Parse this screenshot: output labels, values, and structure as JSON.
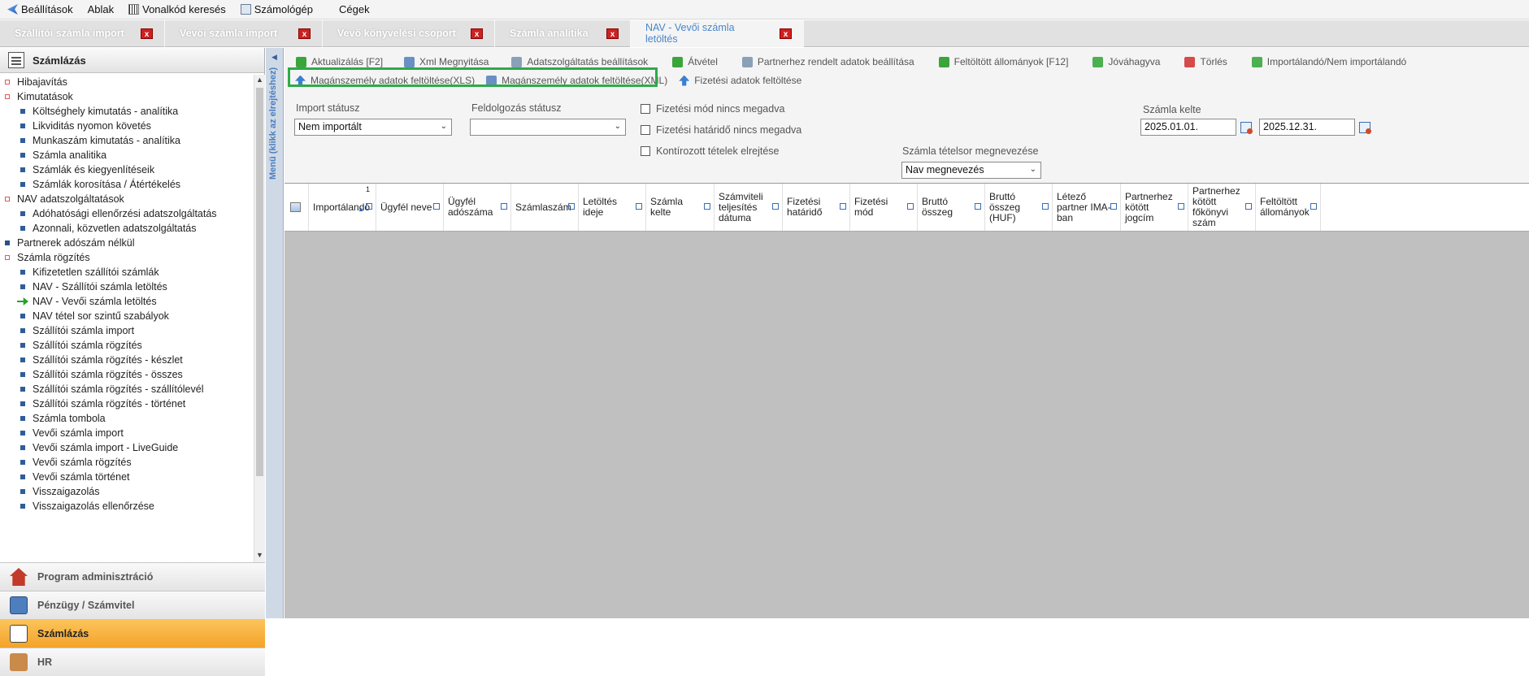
{
  "menubar": {
    "items": [
      {
        "label": "Beállítások",
        "icon": "arrow-icon"
      },
      {
        "label": "Ablak"
      },
      {
        "label": "Vonalkód keresés",
        "icon": "barcode-icon"
      },
      {
        "label": "Számológép",
        "icon": "calculator-icon"
      },
      {
        "label": "Cégek"
      }
    ]
  },
  "tabs": [
    {
      "label": "Szállítói számla import"
    },
    {
      "label": "Vevői számla import"
    },
    {
      "label": "Vevő könyvelési csoport"
    },
    {
      "label": "Számla analitika"
    },
    {
      "label": "NAV - Vevői számla letöltés",
      "active": true
    }
  ],
  "tab_close_glyph": "x",
  "sidebar": {
    "title": "Számlázás",
    "menu_strip_label": "Menü (klikk az elrejtéshez)",
    "tree": [
      {
        "label": "Hibajavítás",
        "level": 0
      },
      {
        "label": "Kimutatások",
        "level": 0
      },
      {
        "label": "Költséghely kimutatás - analítika",
        "level": 1
      },
      {
        "label": "Likviditás nyomon követés",
        "level": 1
      },
      {
        "label": "Munkaszám kimutatás - analítika",
        "level": 1
      },
      {
        "label": "Számla analitika",
        "level": 1
      },
      {
        "label": "Számlák és kiegyenlítéseik",
        "level": 1
      },
      {
        "label": "Számlák korosítása / Átértékelés",
        "level": 1
      },
      {
        "label": "NAV adatszolgáltatások",
        "level": 0
      },
      {
        "label": "Adóhatósági ellenőrzési adatszolgáltatás",
        "level": 1
      },
      {
        "label": "Azonnali, közvetlen adatszolgáltatás",
        "level": 1
      },
      {
        "label": "Partnerek adószám nélkül",
        "level": 0,
        "plain": true
      },
      {
        "label": "Számla rögzítés",
        "level": 0
      },
      {
        "label": "Kifizetetlen szállítói számlák",
        "level": 1
      },
      {
        "label": "NAV - Szállítói számla letöltés",
        "level": 1
      },
      {
        "label": "NAV - Vevői számla letöltés",
        "level": 1,
        "active": true
      },
      {
        "label": "NAV tétel sor szintű szabályok",
        "level": 1
      },
      {
        "label": "Szállítói számla import",
        "level": 1
      },
      {
        "label": "Szállítói számla rögzítés",
        "level": 1
      },
      {
        "label": "Szállítói számla rögzítés - készlet",
        "level": 1
      },
      {
        "label": "Szállítói számla rögzítés - összes",
        "level": 1
      },
      {
        "label": "Szállítói számla rögzítés - szállítólevél",
        "level": 1
      },
      {
        "label": "Szállítói számla rögzítés - történet",
        "level": 1
      },
      {
        "label": "Számla tombola",
        "level": 1
      },
      {
        "label": "Vevői számla import",
        "level": 1
      },
      {
        "label": "Vevői számla import - LiveGuide",
        "level": 1
      },
      {
        "label": "Vevői számla rögzítés",
        "level": 1
      },
      {
        "label": "Vevői számla történet",
        "level": 1
      },
      {
        "label": "Visszaigazolás",
        "level": 1
      },
      {
        "label": "Visszaigazolás ellenőrzése",
        "level": 1
      }
    ],
    "accordion": [
      {
        "label": "Program adminisztráció",
        "icon": "house-icon"
      },
      {
        "label": "Pénzügy / Számvitel",
        "icon": "calculator-icon"
      },
      {
        "label": "Számlázás",
        "icon": "notepad-icon",
        "active": true
      },
      {
        "label": "HR",
        "icon": "people-icon"
      }
    ]
  },
  "toolbar": {
    "row1": [
      {
        "label": "Aktualizálás [F2]",
        "icon": "refresh-icon"
      },
      {
        "label": "Xml Megnyitása",
        "icon": "xml-icon"
      },
      {
        "label": "Adatszolgáltatás beállítások",
        "icon": "settings-icon"
      },
      {
        "label": "Átvétel",
        "icon": "receive-icon"
      },
      {
        "label": "Partnerhez rendelt adatok beállítása",
        "icon": "partner-settings-icon"
      },
      {
        "label": "Feltöltött állományok [F12]",
        "icon": "files-icon"
      },
      {
        "label": "Jóváhagyva",
        "icon": "approved-icon"
      },
      {
        "label": "Törlés",
        "icon": "delete-icon"
      },
      {
        "label": "Importálandó/Nem importálandó",
        "icon": "toggle-import-icon"
      }
    ],
    "row2": [
      {
        "label": "Magánszemély adatok feltöltése(XLS)",
        "icon": "upload-icon"
      },
      {
        "label": "Magánszemély adatok feltöltése(XML)",
        "icon": "upload-xml-icon"
      },
      {
        "label": "Fizetési adatok feltöltése",
        "icon": "upload-icon"
      }
    ]
  },
  "filters": {
    "import_status_label": "Import státusz",
    "import_status_value": "Nem importált",
    "processing_status_label": "Feldolgozás státusz",
    "processing_status_value": "",
    "checkboxes": [
      "Fizetési mód nincs megadva",
      "Fizetési határidő nincs megadva",
      "Kontírozott tételek elrejtése"
    ],
    "invoice_date_label": "Számla kelte",
    "date_from": "2025.01.01.",
    "date_to": "2025.12.31.",
    "line_item_label": "Számla tételsor megnevezése",
    "line_item_value": "Nav megnevezés"
  },
  "grid": {
    "sort_index": "1",
    "columns": [
      "Importálandó",
      "Ügyfél neve",
      "Ügyfél adószáma",
      "Számlaszám",
      "Letöltés ideje",
      "Számla kelte",
      "Számviteli teljesítés dátuma",
      "Fizetési határidő",
      "Fizetési mód",
      "Bruttó összeg",
      "Bruttó összeg (HUF)",
      "Létező partner IMA-ban",
      "Partnerhez kötött jogcím",
      "Partnerhez kötött főkönyvi szám",
      "Feltöltött állományok"
    ]
  }
}
